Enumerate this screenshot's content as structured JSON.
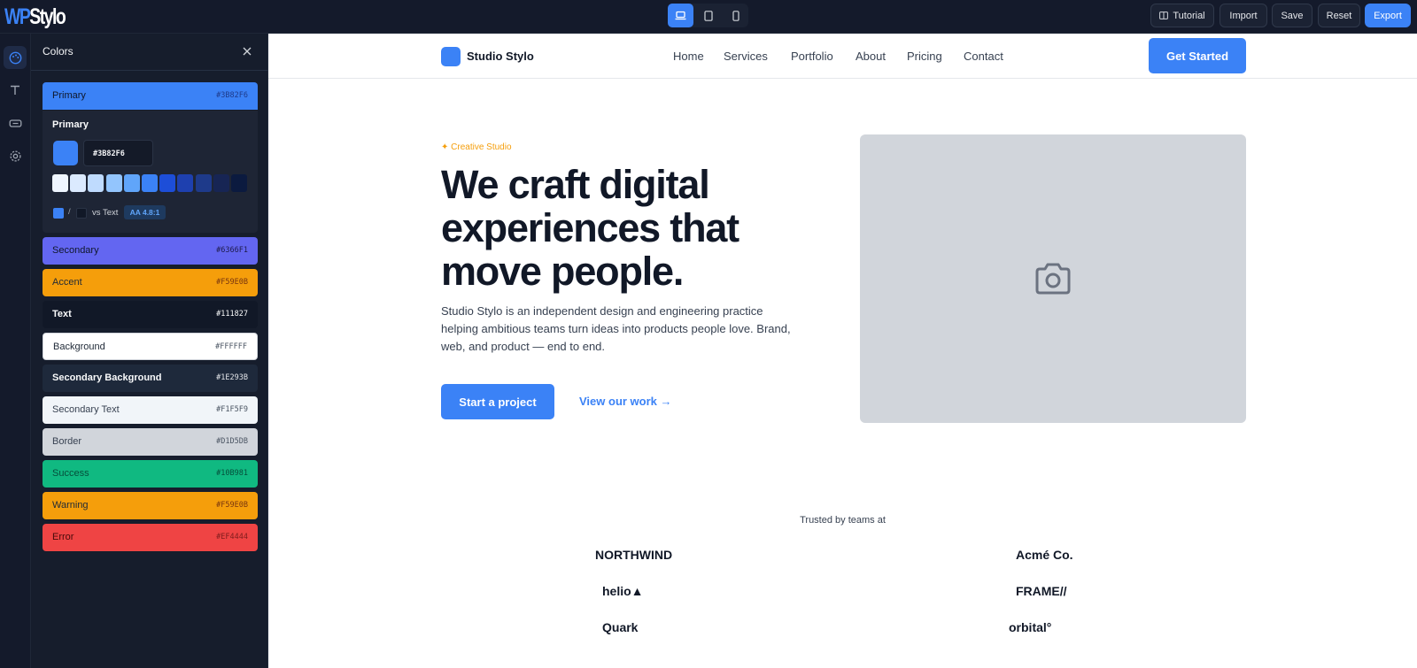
{
  "app": {
    "logo_left": "WP",
    "logo_right": "Stylo",
    "devices": [
      {
        "name": "desktop",
        "active": true
      },
      {
        "name": "tablet",
        "active": false
      },
      {
        "name": "mobile",
        "active": false
      }
    ],
    "buttons": {
      "tutorial": "Tutorial",
      "import": "Import",
      "save": "Save",
      "reset": "Reset",
      "export": "Export"
    },
    "accent": "#3B82F6"
  },
  "rail": [
    {
      "icon": "palette-icon",
      "active": true
    },
    {
      "icon": "typography-icon",
      "active": false
    },
    {
      "icon": "button-icon",
      "active": false
    },
    {
      "icon": "gear-icon",
      "active": false
    }
  ],
  "panel": {
    "title": "Colors",
    "expanded": {
      "label": "Primary",
      "hex": "#3B82F6",
      "shades": [
        "#EFF6FF",
        "#DBEAFE",
        "#BFDBFE",
        "#93C5FD",
        "#60A5FA",
        "#3B82F6",
        "#1D4ED8",
        "#1E40AF",
        "#1E3A8A",
        "#172554",
        "#0B1A3F"
      ],
      "contrast_fg": "#3B82F6",
      "contrast_bg": "#111827",
      "contrast_slash": "/",
      "contrast_label": "vs Text",
      "contrast_badge": "AA 4.8:1"
    },
    "colors": [
      {
        "name": "Primary",
        "hex": "#3B82F6",
        "bg": "#3B82F6",
        "fg": "#0F172A",
        "hexfg": "#1E3A8A",
        "border": ""
      },
      {
        "name": "Secondary",
        "hex": "#6366F1",
        "bg": "#6366F1",
        "fg": "#0F172A",
        "hexfg": "#1E1B4B",
        "border": ""
      },
      {
        "name": "Accent",
        "hex": "#F59E0B",
        "bg": "#F59E0B",
        "fg": "#1F2937",
        "hexfg": "#78350F",
        "border": ""
      },
      {
        "name": "Text",
        "hex": "#111827",
        "bg": "#111827",
        "fg": "#F9FAFB",
        "hexfg": "#F9FAFB",
        "border": ""
      },
      {
        "name": "Background",
        "hex": "#FFFFFF",
        "bg": "#FFFFFF",
        "fg": "#1F2937",
        "hexfg": "#4B5563",
        "border": "#D1D5DB"
      },
      {
        "name": "Secondary Background",
        "hex": "#1E293B",
        "bg": "#1E293B",
        "fg": "#F9FAFB",
        "hexfg": "#E5E7EB",
        "border": ""
      },
      {
        "name": "Secondary Text",
        "hex": "#F1F5F9",
        "bg": "#F1F5F9",
        "fg": "#374151",
        "hexfg": "#4B5563",
        "border": ""
      },
      {
        "name": "Border",
        "hex": "#D1D5DB",
        "bg": "#D1D5DB",
        "fg": "#374151",
        "hexfg": "#4B5563",
        "border": ""
      },
      {
        "name": "Success",
        "hex": "#10B981",
        "bg": "#10B981",
        "fg": "#064E3B",
        "hexfg": "#064E3B",
        "border": ""
      },
      {
        "name": "Warning",
        "hex": "#F59E0B",
        "bg": "#F59E0B",
        "fg": "#1F2937",
        "hexfg": "#78350F",
        "border": ""
      },
      {
        "name": "Error",
        "hex": "#EF4444",
        "bg": "#EF4444",
        "fg": "#450A0A",
        "hexfg": "#7F1D1D",
        "border": ""
      }
    ]
  },
  "site": {
    "brand": "Studio Stylo",
    "nav": [
      "Home",
      "Services",
      "Portfolio",
      "About",
      "Pricing",
      "Contact"
    ],
    "cta": "Get Started",
    "eyebrow": "✦ Creative Studio",
    "hero_title": "We craft digital experiences that move people.",
    "hero_body": "Studio Stylo is an independent design and engineering practice helping ambitious teams turn ideas into products people love. Brand, web, and product — end to end.",
    "primary_button": "Start a project",
    "secondary_link": "View our work →",
    "trusted_label": "Trusted by teams at",
    "logos": [
      "NORTHWIND",
      "Acmé Co.",
      "helio▲",
      "FRAME//",
      "Quark",
      "orbital°"
    ]
  }
}
